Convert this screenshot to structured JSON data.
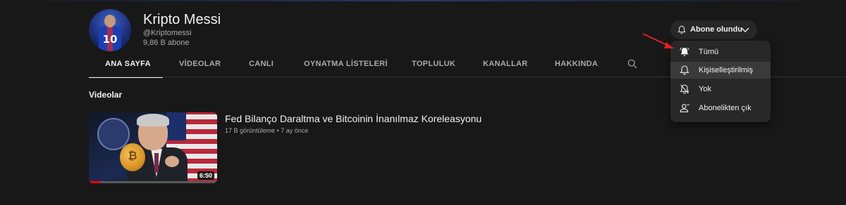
{
  "channel": {
    "name": "Kripto Messi",
    "handle": "@Kriptomessi",
    "subscribers": "9,86 B abone",
    "avatar_icon": "messi-avatar",
    "avatar_number": "10"
  },
  "subscribe_button": {
    "label": "Abone olundu",
    "icon": "bell-icon",
    "dropdown_icon": "chevron-down-icon"
  },
  "tabs": [
    {
      "label": "ANA SAYFA",
      "active": true
    },
    {
      "label": "VİDEOLAR",
      "active": false
    },
    {
      "label": "CANLI",
      "active": false
    },
    {
      "label": "OYNATMA LİSTELERİ",
      "active": false
    },
    {
      "label": "TOPLULUK",
      "active": false
    },
    {
      "label": "KANALLAR",
      "active": false
    },
    {
      "label": "HAKKINDA",
      "active": false
    }
  ],
  "tabs_search_icon": "search-icon",
  "section": {
    "title": "Videolar"
  },
  "video": {
    "title": "Fed Bilanço Daraltma ve Bitcoinin İnanılmaz Koreleasyonu",
    "views": "17 B görüntüleme",
    "age": "7 ay önce",
    "meta_separator": "•",
    "duration": "6:50",
    "watched_fraction": 0.09,
    "coin_symbol": "₿"
  },
  "notification_menu": {
    "items": [
      {
        "label": "Tümü",
        "icon": "bell-filled-icon",
        "highlighted": false
      },
      {
        "label": "Kişiselleştirilmiş",
        "icon": "bell-icon",
        "highlighted": true
      },
      {
        "label": "Yok",
        "icon": "bell-off-icon",
        "highlighted": false
      },
      {
        "label": "Abonelikten çık",
        "icon": "unsubscribe-person-icon",
        "highlighted": false
      }
    ]
  },
  "colors": {
    "background": "#181818",
    "menu_background": "#282828",
    "menu_highlight": "#3a3a3a",
    "text_primary": "#f1f1f1",
    "text_secondary": "#aaaaaa",
    "progress": "#ff0000",
    "annotation_arrow": "#e02020"
  }
}
